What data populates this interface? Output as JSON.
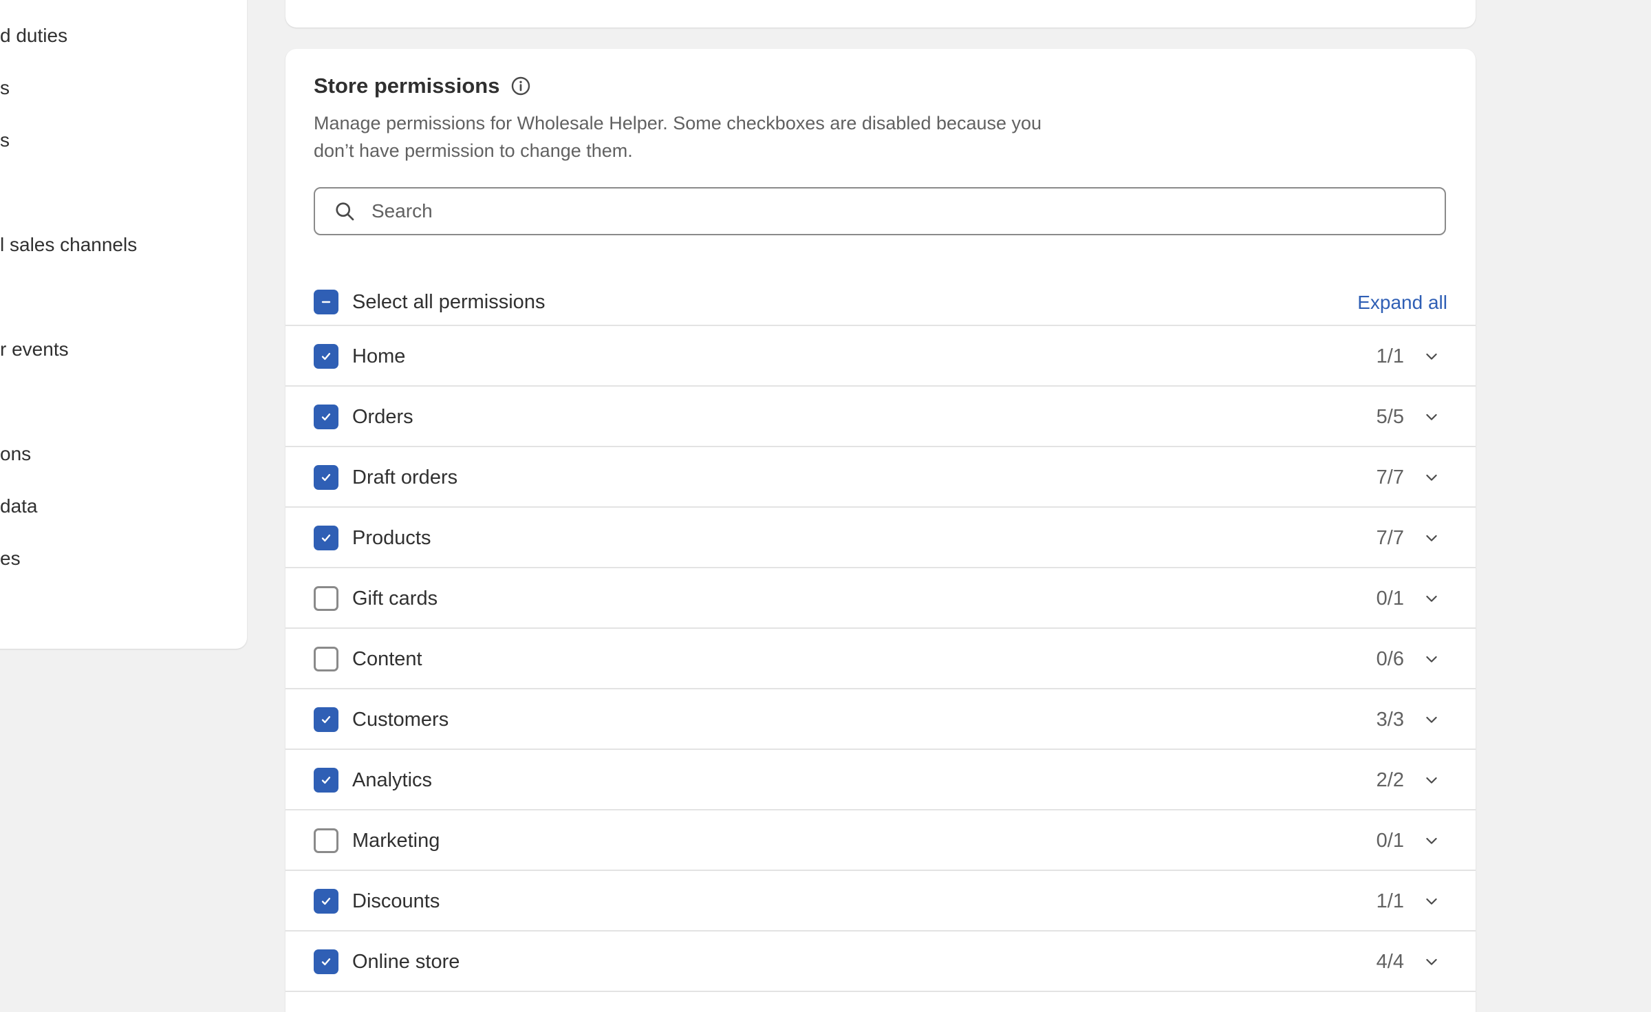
{
  "sidebar": {
    "items": [
      {
        "label": "d duties"
      },
      {
        "label": "s"
      },
      {
        "label": "s"
      },
      {
        "label": "l sales channels"
      },
      {
        "label": "r events"
      },
      {
        "label": "ons"
      },
      {
        "label": "data"
      },
      {
        "label": "es"
      }
    ]
  },
  "permissions": {
    "title": "Store permissions",
    "description": "Manage permissions for Wholesale Helper. Some checkboxes are disabled because you don’t have permission to change them.",
    "search_placeholder": "Search",
    "select_all_label": "Select all permissions",
    "expand_all_label": "Expand all",
    "rows": [
      {
        "label": "Home",
        "count": "1/1",
        "checked": true
      },
      {
        "label": "Orders",
        "count": "5/5",
        "checked": true
      },
      {
        "label": "Draft orders",
        "count": "7/7",
        "checked": true
      },
      {
        "label": "Products",
        "count": "7/7",
        "checked": true
      },
      {
        "label": "Gift cards",
        "count": "0/1",
        "checked": false
      },
      {
        "label": "Content",
        "count": "0/6",
        "checked": false
      },
      {
        "label": "Customers",
        "count": "3/3",
        "checked": true
      },
      {
        "label": "Analytics",
        "count": "2/2",
        "checked": true
      },
      {
        "label": "Marketing",
        "count": "0/1",
        "checked": false
      },
      {
        "label": "Discounts",
        "count": "1/1",
        "checked": true
      },
      {
        "label": "Online store",
        "count": "4/4",
        "checked": true
      }
    ]
  },
  "colors": {
    "accent": "#2f5fb5",
    "background": "#f1f1f1",
    "card": "#ffffff"
  },
  "icons": {
    "info": "info-icon",
    "search": "search-icon",
    "chevron": "chevron-down-icon",
    "check": "checkmark-icon",
    "minus": "minus-icon"
  }
}
